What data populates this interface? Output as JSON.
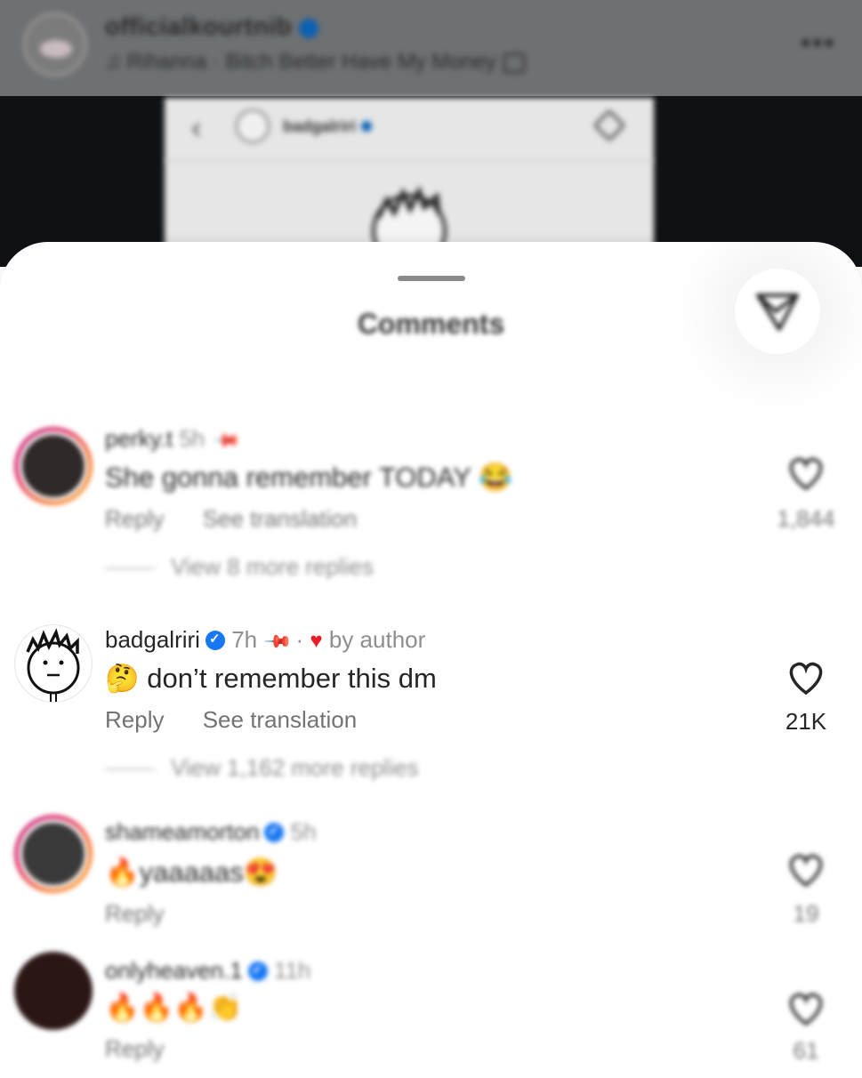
{
  "post_header": {
    "username": "officialkourtnib",
    "audio": "Rihanna · Bitch Better Have My Money",
    "more_icon": "more-horizontal-icon"
  },
  "embedded_post": {
    "username": "badgalriri"
  },
  "sheet": {
    "title": "Comments",
    "share_icon": "send-icon"
  },
  "comments": [
    {
      "username": "perky.t",
      "time": "5h",
      "text": "She gonna remember TODAY 😂",
      "reply_label": "Reply",
      "translate_label": "See translation",
      "likes": "1,844",
      "view_replies": "View 8 more replies"
    },
    {
      "username": "badgalriri",
      "time": "7h",
      "author_like": "by author",
      "text": "🤔 don’t remember this dm",
      "reply_label": "Reply",
      "translate_label": "See translation",
      "likes": "21K",
      "view_replies": "View 1,162 more replies"
    },
    {
      "username": "shameamorton",
      "time": "5h",
      "text": "🔥yaaaaas😍",
      "reply_label": "Reply",
      "likes": "19"
    },
    {
      "username": "onlyheaven.1",
      "time": "11h",
      "text": "🔥🔥🔥👏",
      "reply_label": "Reply",
      "likes": "61"
    }
  ]
}
